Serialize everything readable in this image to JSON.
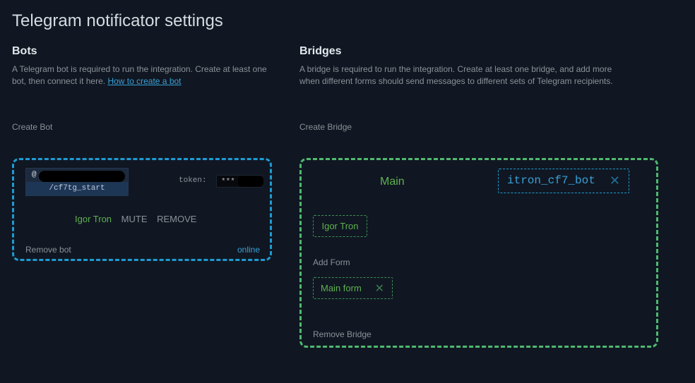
{
  "page": {
    "title": "Telegram notificator settings"
  },
  "bots": {
    "heading": "Bots",
    "description": "A Telegram bot is required to run the integration. Create at least one bot, then connect it here.",
    "help_link": "How to create a bot",
    "create_label": "Create Bot",
    "card": {
      "handle_prefix": "@",
      "start_command": "/cf7tg_start",
      "token_label": "token:",
      "token_value": "***",
      "recipient_name": "Igor Tron",
      "mute_label": "MUTE",
      "remove_label": "REMOVE",
      "remove_bot_label": "Remove bot",
      "status": "online"
    }
  },
  "bridges": {
    "heading": "Bridges",
    "description": "A bridge is required to run the integration. Create at least one bridge, and add more when different forms should send messages to different sets of Telegram recipients.",
    "create_label": "Create Bridge",
    "card": {
      "name": "Main",
      "bot_tag": "itron_cf7_bot",
      "recipient_tag": "Igor Tron",
      "add_form_label": "Add Form",
      "form_tag": "Main form",
      "remove_bridge_label": "Remove Bridge"
    }
  },
  "icons": {
    "remove_tag": "close-icon"
  },
  "colors": {
    "background": "#101722",
    "bot_border": "#1e9bd2",
    "bridge_border": "#4fb870",
    "accent_green": "#5fb14f",
    "link_blue": "#3aa0d6"
  }
}
